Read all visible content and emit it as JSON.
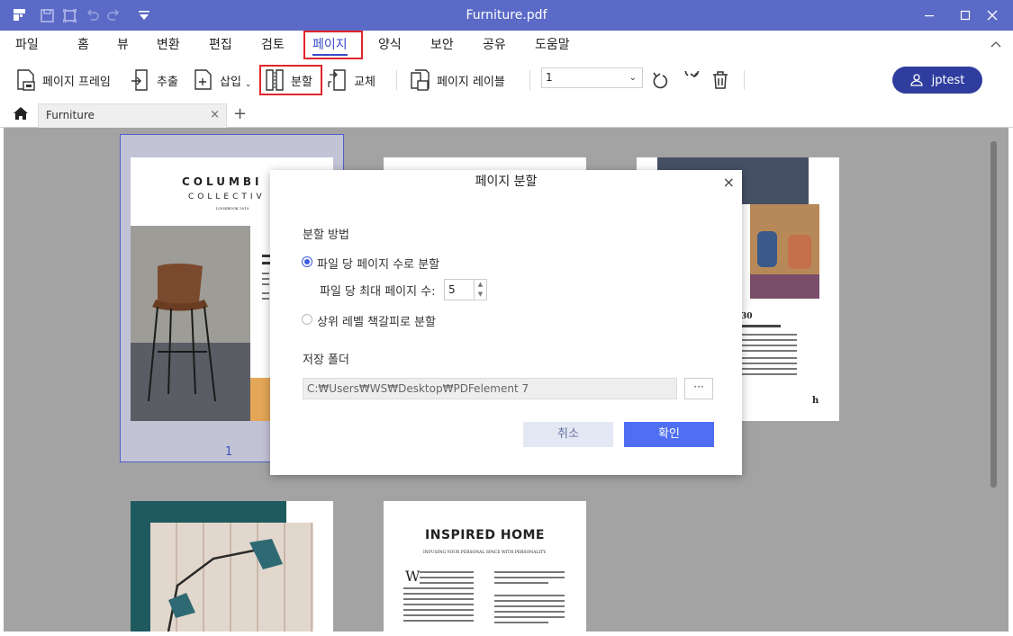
{
  "titlebar": {
    "title": "Furniture.pdf"
  },
  "menu": [
    {
      "label": "파일"
    },
    {
      "label": "홈"
    },
    {
      "label": "뷰"
    },
    {
      "label": "변환"
    },
    {
      "label": "편집"
    },
    {
      "label": "검토"
    },
    {
      "label": "페이지"
    },
    {
      "label": "양식"
    },
    {
      "label": "보안"
    },
    {
      "label": "공유"
    },
    {
      "label": "도움말"
    }
  ],
  "toolbar": {
    "page_frame": "페이지 프레임",
    "extract": "추출",
    "insert": "삽입",
    "split": "분할",
    "replace": "교체",
    "page_label": "페이지 레이블",
    "page_select_value": "1",
    "user_name": "jptest"
  },
  "tab": {
    "name": "Furniture"
  },
  "pages": {
    "page1_number": "1",
    "p1_title": "COLUMBI",
    "p1_sub": "COLLECTIV",
    "p1_small": "LOOKBOOK 2019",
    "p5_title": "INSPIRED HOME",
    "p5_sub": "INFUSING YOUR PERSONAL SPACE WITH PERSONALITY."
  },
  "dialog": {
    "title": "페이지 분할",
    "method_label": "분할 방법",
    "option1": "파일 당 페이지 수로 분할",
    "max_pages_label": "파일 당 최대 페이지 수:",
    "max_pages_value": "5",
    "option2": "상위 레벨 책갈피로 분할",
    "folder_label": "저장 폴더",
    "folder_path": "C:₩Users₩WS₩Desktop₩PDFelement 7",
    "browse": "···",
    "cancel": "취소",
    "ok": "확인"
  }
}
